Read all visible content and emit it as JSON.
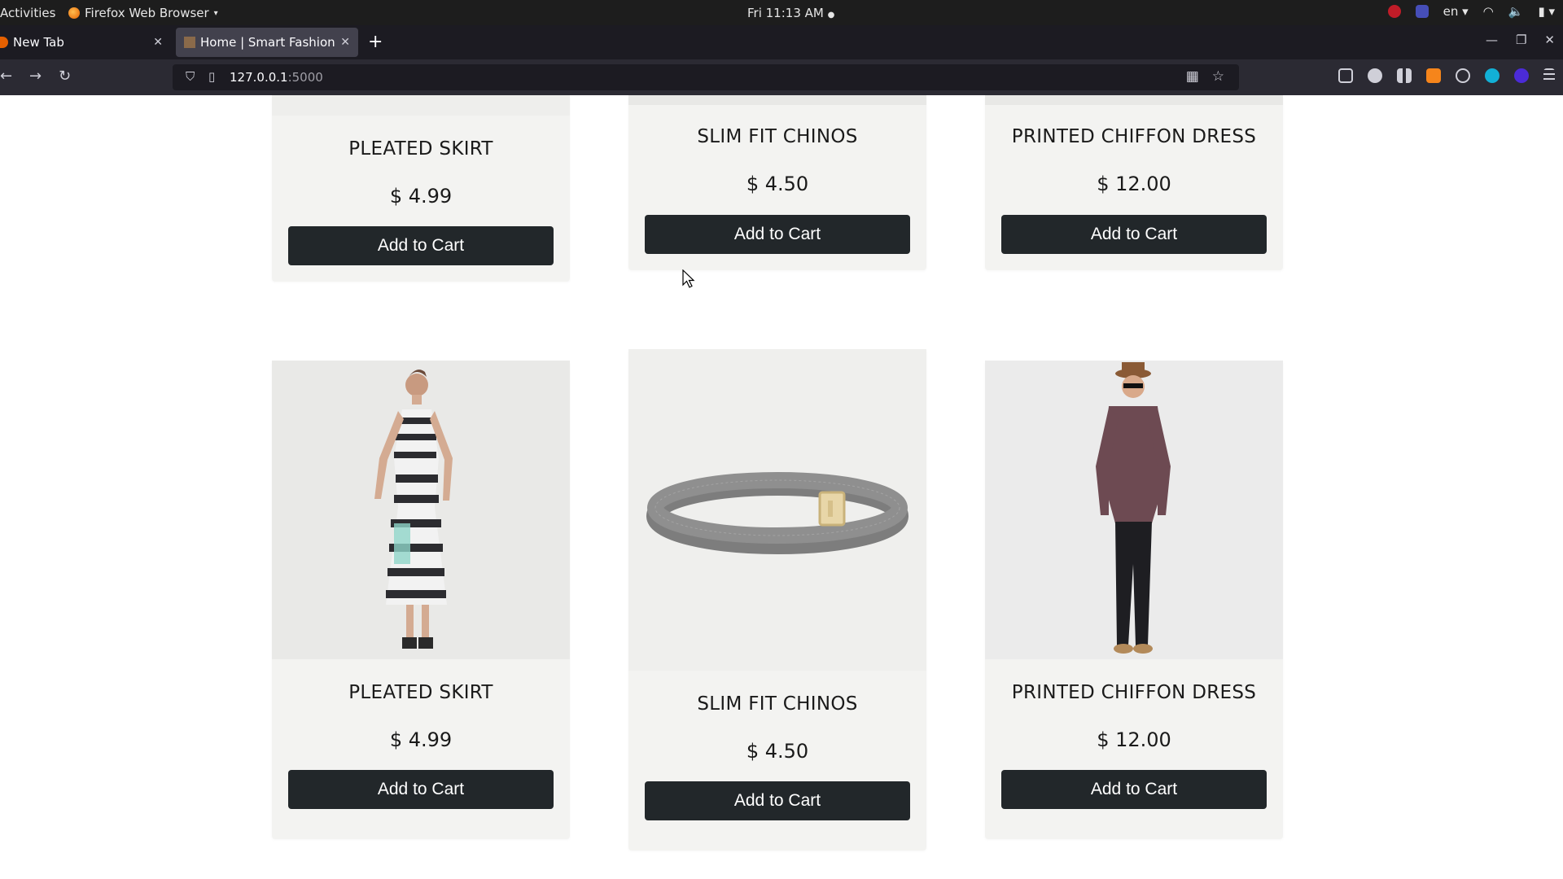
{
  "system_bar": {
    "activities": "Activities",
    "app_name": "Firefox Web Browser",
    "clock": "Fri 11:13 AM",
    "language": "en"
  },
  "browser": {
    "tabs": [
      {
        "label": "New Tab",
        "active": false
      },
      {
        "label": "Home | Smart Fashion",
        "active": true
      }
    ],
    "url_host": "127.0.0.1",
    "url_port": ":5000"
  },
  "products_row1": [
    {
      "title": "PLEATED SKIRT",
      "price": "$ 4.99",
      "button": "Add to Cart"
    },
    {
      "title": "SLIM FIT CHINOS",
      "price": "$ 4.50",
      "button": "Add to Cart"
    },
    {
      "title": "PRINTED CHIFFON DRESS",
      "price": "$ 12.00",
      "button": "Add to Cart"
    }
  ],
  "products_row2": [
    {
      "title": "PLEATED SKIRT",
      "price": "$ 4.99",
      "button": "Add to Cart",
      "image": "woman-striped-dress"
    },
    {
      "title": "SLIM FIT CHINOS",
      "price": "$ 4.50",
      "button": "Add to Cart",
      "image": "grey-leather-belt"
    },
    {
      "title": "PRINTED CHIFFON DRESS",
      "price": "$ 12.00",
      "button": "Add to Cart",
      "image": "man-in-hat"
    }
  ],
  "colors": {
    "button_bg": "#22272a",
    "card_bg": "#f3f3f1",
    "browser_chrome": "#1c1b22"
  }
}
